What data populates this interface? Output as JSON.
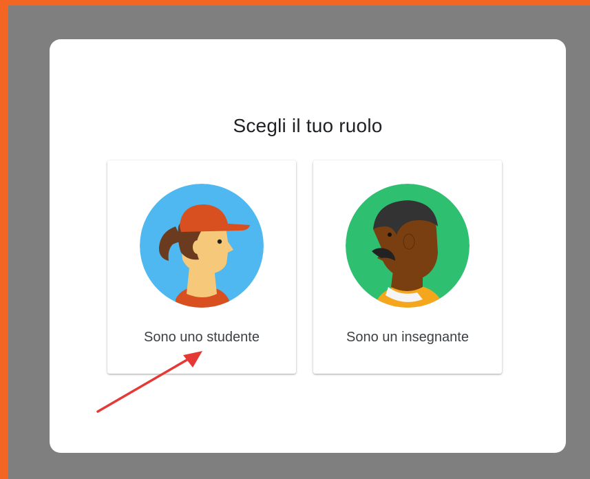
{
  "dialog": {
    "title": "Scegli il tuo ruolo"
  },
  "roles": [
    {
      "label": "Sono uno studente",
      "icon": "student-avatar-icon"
    },
    {
      "label": "Sono un insegnante",
      "icon": "teacher-avatar-icon"
    }
  ],
  "annotation": {
    "icon": "red-arrow-icon",
    "color": "#e53935"
  },
  "colors": {
    "frame": "#f26522",
    "backdrop": "#7f7f7f",
    "student_bg": "#4fb8f0",
    "teacher_bg": "#2fbf71"
  }
}
